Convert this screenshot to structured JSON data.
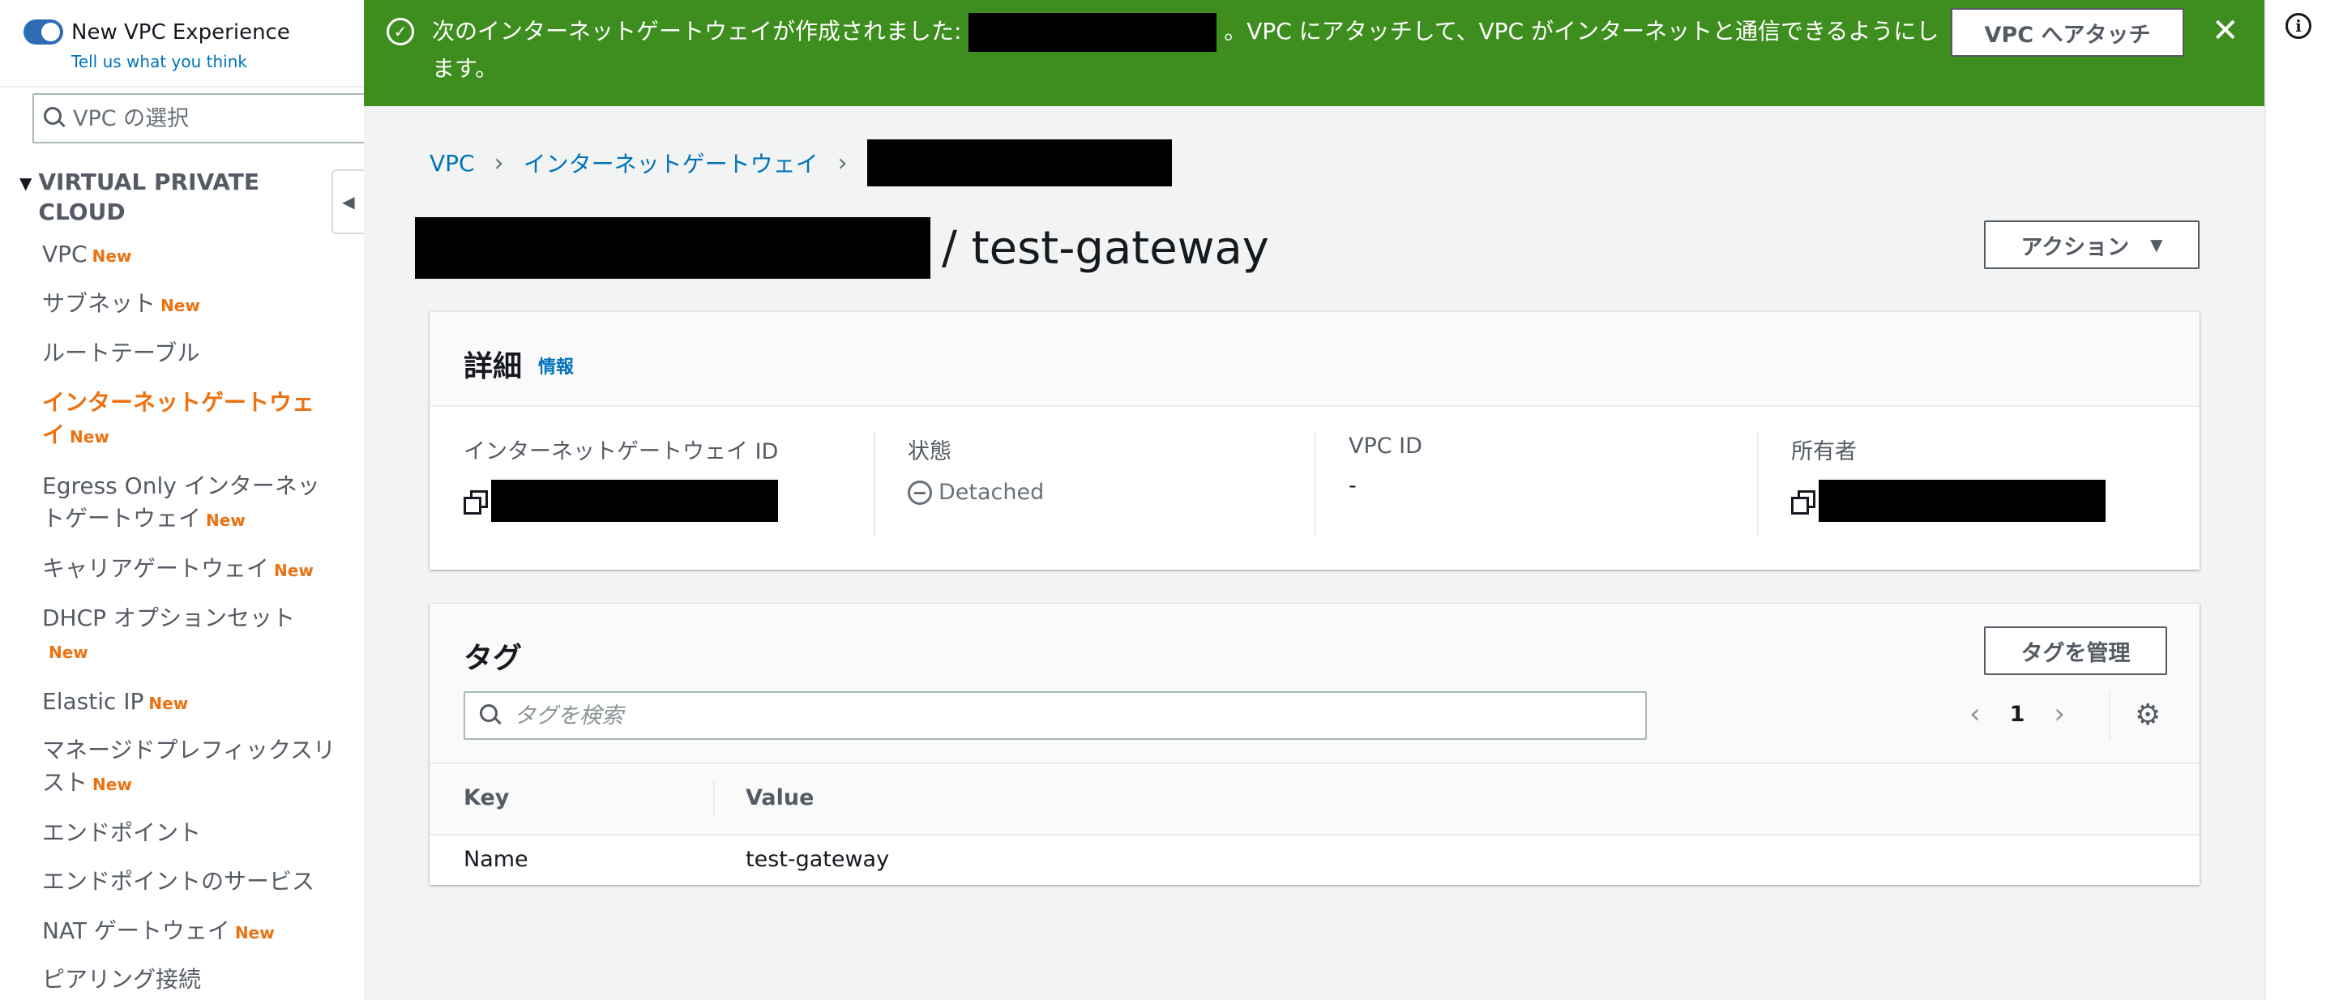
{
  "sidebar": {
    "toggle_label": "New VPC Experience",
    "feedback_link": "Tell us what you think",
    "vpc_search_placeholder": "VPC の選択",
    "section_title": "VIRTUAL PRIVATE CLOUD",
    "new_badge": "New",
    "items": [
      {
        "label": "VPC",
        "new": true
      },
      {
        "label": "サブネット",
        "new": true
      },
      {
        "label": "ルートテーブル",
        "new": false
      },
      {
        "label": "インターネットゲートウェイ",
        "new": true,
        "active": true
      },
      {
        "label": "Egress Only インターネットゲートウェイ",
        "new": true
      },
      {
        "label": "キャリアゲートウェイ",
        "new": true
      },
      {
        "label": "DHCP オプションセット",
        "new": true
      },
      {
        "label": "Elastic IP",
        "new": true
      },
      {
        "label": "マネージドプレフィックスリスト",
        "new": true
      },
      {
        "label": "エンドポイント",
        "new": false
      },
      {
        "label": "エンドポイントのサービス",
        "new": false
      },
      {
        "label": "NAT ゲートウェイ",
        "new": true
      },
      {
        "label": "ピアリング接続",
        "new": false
      }
    ]
  },
  "flash": {
    "message_prefix": "次のインターネットゲートウェイが作成されました:",
    "message_suffix": "。VPC にアタッチして、VPC がインターネットと通信できるようにします。",
    "attach_button": "VPC へアタッチ",
    "close_symbol": "✕"
  },
  "breadcrumb": {
    "items": [
      "VPC",
      "インターネットゲートウェイ"
    ]
  },
  "header": {
    "title": "/ test-gateway",
    "actions_button": "アクション"
  },
  "details": {
    "heading": "詳細",
    "info_link": "情報",
    "fields": {
      "igw_id_label": "インターネットゲートウェイ ID",
      "state_label": "状態",
      "state_value": "Detached",
      "vpc_id_label": "VPC ID",
      "vpc_id_value": "-",
      "owner_label": "所有者"
    }
  },
  "tags": {
    "heading": "タグ",
    "manage_button": "タグを管理",
    "search_placeholder": "タグを検索",
    "page_number": "1",
    "columns": [
      "Key",
      "Value"
    ],
    "rows": [
      {
        "key": "Name",
        "value": "test-gateway"
      }
    ]
  },
  "icons": {
    "flash_status": "check-circle-icon",
    "info_rail": "info-icon",
    "settings": "gear-icon"
  },
  "colors": {
    "flash_bg": "#3e8e1f",
    "link": "#0073bb",
    "active_nav": "#ec7211",
    "toggle": "#2d6cb5"
  }
}
